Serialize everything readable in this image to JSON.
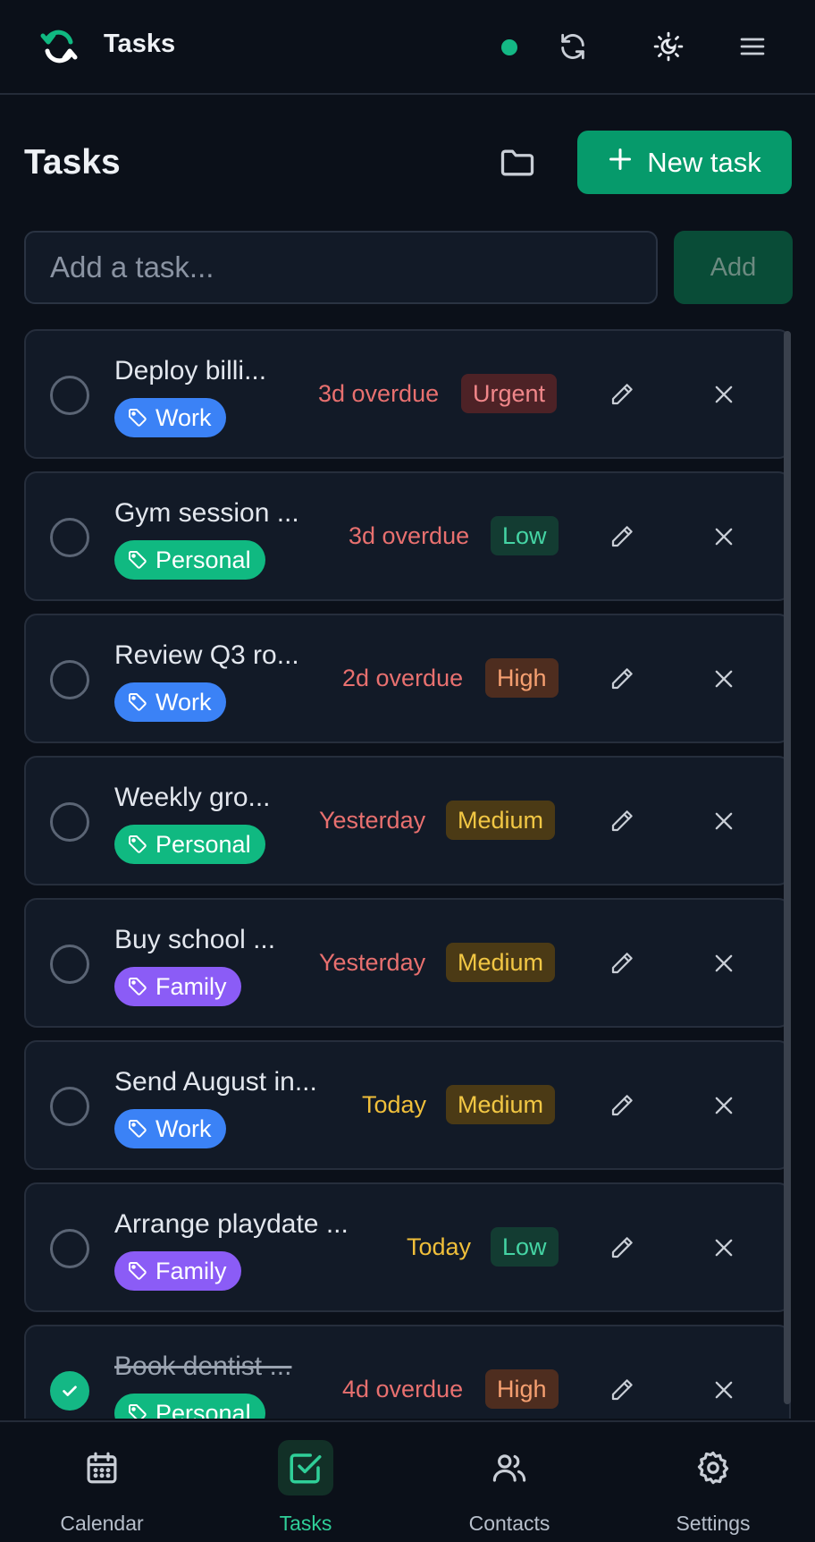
{
  "header": {
    "app_title": "Tasks",
    "status": "online",
    "icons": [
      "sync-icon",
      "theme-icon",
      "menu-icon"
    ]
  },
  "main": {
    "title": "Tasks",
    "new_task_label": "New task",
    "add_placeholder": "Add a task...",
    "add_label": "Add"
  },
  "colors": {
    "accent": "#069a6b",
    "overdue": "#e8706f",
    "today": "#f0bf3a",
    "tag_work": "#3b82f6",
    "tag_personal": "#10b981",
    "tag_family": "#8b5cf6"
  },
  "tasks": [
    {
      "title": "Deploy billi...",
      "tag": "Work",
      "due": "3d overdue",
      "priority": "Urgent",
      "done": false
    },
    {
      "title": "Gym session ...",
      "tag": "Personal",
      "due": "3d overdue",
      "priority": "Low",
      "done": false
    },
    {
      "title": "Review Q3 ro...",
      "tag": "Work",
      "due": "2d overdue",
      "priority": "High",
      "done": false
    },
    {
      "title": "Weekly gro...",
      "tag": "Personal",
      "due": "Yesterday",
      "priority": "Medium",
      "done": false
    },
    {
      "title": "Buy school ...",
      "tag": "Family",
      "due": "Yesterday",
      "priority": "Medium",
      "done": false
    },
    {
      "title": "Send August in...",
      "tag": "Work",
      "due": "Today",
      "priority": "Medium",
      "done": false
    },
    {
      "title": "Arrange playdate ...",
      "tag": "Family",
      "due": "Today",
      "priority": "Low",
      "done": false
    },
    {
      "title": "Book dentist ...",
      "tag": "Personal",
      "due": "4d overdue",
      "priority": "High",
      "done": true
    }
  ],
  "nav": [
    {
      "label": "Calendar",
      "icon": "calendar-icon",
      "active": false
    },
    {
      "label": "Tasks",
      "icon": "tasks-icon",
      "active": true
    },
    {
      "label": "Contacts",
      "icon": "contacts-icon",
      "active": false
    },
    {
      "label": "Settings",
      "icon": "settings-icon",
      "active": false
    }
  ]
}
